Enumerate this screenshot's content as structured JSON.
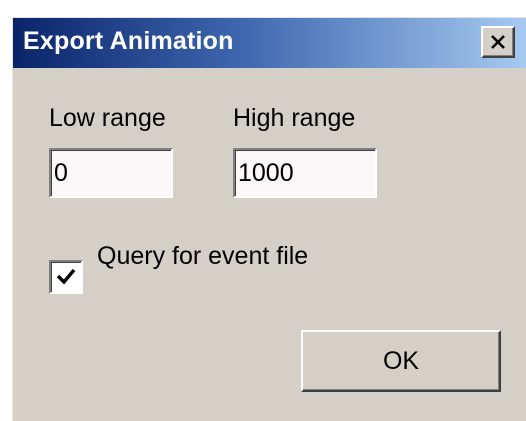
{
  "window": {
    "title": "Export Animation",
    "close_label": "close",
    "close_icon": "close-icon"
  },
  "form": {
    "low_range_label": "Low range",
    "low_range_value": "0",
    "high_range_label": "High range",
    "high_range_value": "1000",
    "query_checkbox_label": "Query for event file",
    "query_checked": true,
    "check_icon": "checkmark-icon"
  },
  "buttons": {
    "ok_label": "OK"
  },
  "colors": {
    "dialog_face": "#d4d0c8",
    "title_gradient_start": "#0a246a",
    "title_gradient_end": "#a6caf0",
    "title_text": "#ffffff",
    "field_background": "#fbf6f7"
  }
}
